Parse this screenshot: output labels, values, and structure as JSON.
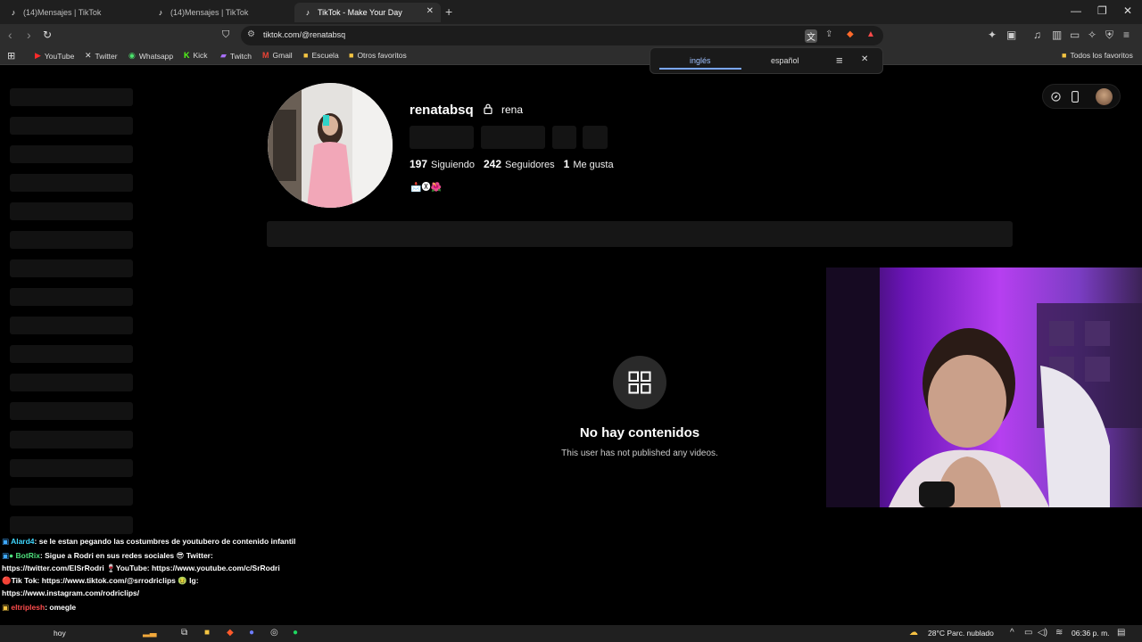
{
  "browser": {
    "tabs": [
      {
        "title": "(14)Mensajes | TikTok",
        "active": false
      },
      {
        "title": "(14)Mensajes | TikTok",
        "active": false
      },
      {
        "title": "TikTok - Make Your Day",
        "active": true
      }
    ],
    "url": "tiktok.com/@renatabsq",
    "bookmarks": [
      {
        "label": "YouTube",
        "icon": "youtube-icon"
      },
      {
        "label": "Twitter",
        "icon": "x-icon"
      },
      {
        "label": "Whatsapp",
        "icon": "whatsapp-icon"
      },
      {
        "label": "Kick",
        "icon": "kick-icon"
      },
      {
        "label": "Twitch",
        "icon": "twitch-icon"
      },
      {
        "label": "Gmail",
        "icon": "gmail-icon"
      },
      {
        "label": "Escuela",
        "icon": "folder-icon"
      },
      {
        "label": "Otros favoritos",
        "icon": "folder-icon"
      }
    ],
    "all_bookmarks": "Todos los favoritos",
    "translate": {
      "source": "inglés",
      "target": "español"
    }
  },
  "profile": {
    "username": "renatabsq",
    "nickname": "rena",
    "following_count": "197",
    "following_label": "Siguiendo",
    "followers_count": "242",
    "followers_label": "Seguidores",
    "likes_count": "1",
    "likes_label": "Me gusta",
    "bio": "📩🅧🌺"
  },
  "empty_state": {
    "title": "No hay contenidos",
    "subtitle": "This user has not published any videos."
  },
  "chat": [
    {
      "user": "Alard4",
      "text": ": se le estan pegando las costumbres de youtubero de contenido infantil"
    },
    {
      "user": "BotRix",
      "text": ": Sigue a Rodri en sus redes sociales 😎 Twitter: https://twitter.com/ElSrRodri 🍷YouTube: https://www.youtube.com/c/SrRodri 🔴Tik Tok: https://www.tiktok.com/@srrodriclips 🤢 Ig: https://www.instagram.com/rodriclips/"
    },
    {
      "user": "eltriplesh",
      "text": ": omegle"
    },
    {
      "user": "",
      "text": "hoy"
    }
  ],
  "taskbar": {
    "weather": "28°C  Parc. nublado",
    "time": "06:36 p. m."
  }
}
